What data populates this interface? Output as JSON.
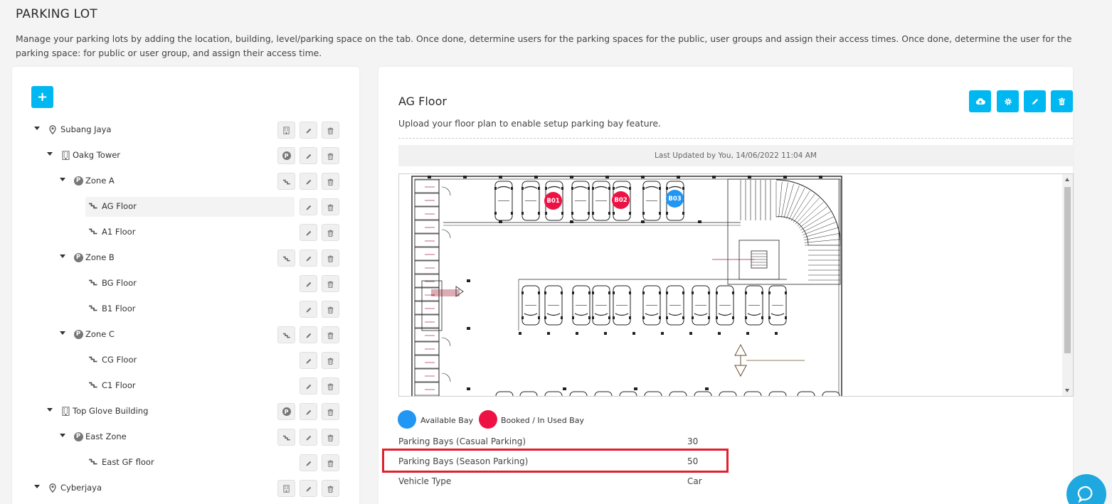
{
  "page": {
    "title": "PARKING LOT",
    "description": "Manage your parking lots by adding the location, building, level/parking space on the tab. Once done, determine users for the parking spaces for the public, user groups and assign their access times. Once done, determine the user for the parking space: for public or user group, and assign their access time."
  },
  "tree": {
    "add_icon": "plus-icon",
    "nodes": [
      {
        "label": "Subang Jaya",
        "type": "location",
        "icon": "map-pin-icon",
        "action": "building-icon"
      },
      {
        "label": "Oakg Tower",
        "type": "building",
        "icon": "building-icon",
        "action": "parking-icon"
      },
      {
        "label": "Zone A",
        "type": "zone",
        "icon": "parking-icon",
        "action": "stairs-icon"
      },
      {
        "label": "AG Floor",
        "type": "floor",
        "icon": "stairs-icon",
        "selected": true
      },
      {
        "label": "A1 Floor",
        "type": "floor",
        "icon": "stairs-icon"
      },
      {
        "label": "Zone B",
        "type": "zone",
        "icon": "parking-icon",
        "action": "stairs-icon"
      },
      {
        "label": "BG Floor",
        "type": "floor",
        "icon": "stairs-icon"
      },
      {
        "label": "B1 Floor",
        "type": "floor",
        "icon": "stairs-icon"
      },
      {
        "label": "Zone C",
        "type": "zone",
        "icon": "parking-icon",
        "action": "stairs-icon"
      },
      {
        "label": "CG Floor",
        "type": "floor",
        "icon": "stairs-icon"
      },
      {
        "label": "C1 Floor",
        "type": "floor",
        "icon": "stairs-icon"
      },
      {
        "label": "Top Glove Building",
        "type": "building",
        "icon": "building-icon",
        "action": "parking-icon"
      },
      {
        "label": "East Zone",
        "type": "zone",
        "icon": "parking-icon",
        "action": "stairs-icon"
      },
      {
        "label": "East GF floor",
        "type": "floor",
        "icon": "stairs-icon"
      },
      {
        "label": "Cyberjaya",
        "type": "location",
        "icon": "map-pin-icon",
        "action": "building-icon"
      }
    ]
  },
  "floor": {
    "title": "AG Floor",
    "description": "Upload your floor plan to enable setup parking bay feature.",
    "last_updated": "Last Updated by You, 14/06/2022 11:04 AM",
    "header_actions": [
      "upload-cloud-icon",
      "gear-icon",
      "pencil-icon",
      "trash-icon"
    ],
    "bays": [
      {
        "label": "B01",
        "status": "booked"
      },
      {
        "label": "B02",
        "status": "booked"
      },
      {
        "label": "B03",
        "status": "available"
      }
    ],
    "legend": [
      {
        "label": "Available Bay",
        "color": "#2196f3"
      },
      {
        "label": "Booked / In Used Bay",
        "color": "#ee1244"
      }
    ],
    "info": [
      {
        "label": "Parking Bays (Casual Parking)",
        "value": "30"
      },
      {
        "label": "Parking Bays (Season Parking)",
        "value": "50"
      },
      {
        "label": "Vehicle Type",
        "value": "Car"
      }
    ]
  },
  "colors": {
    "accent": "#00b8f1",
    "available": "#2196f3",
    "booked": "#ee1244",
    "highlight": "#e0202e",
    "chat": "#1fa8e0"
  },
  "chat": {
    "icon": "chat-bubble-icon"
  }
}
